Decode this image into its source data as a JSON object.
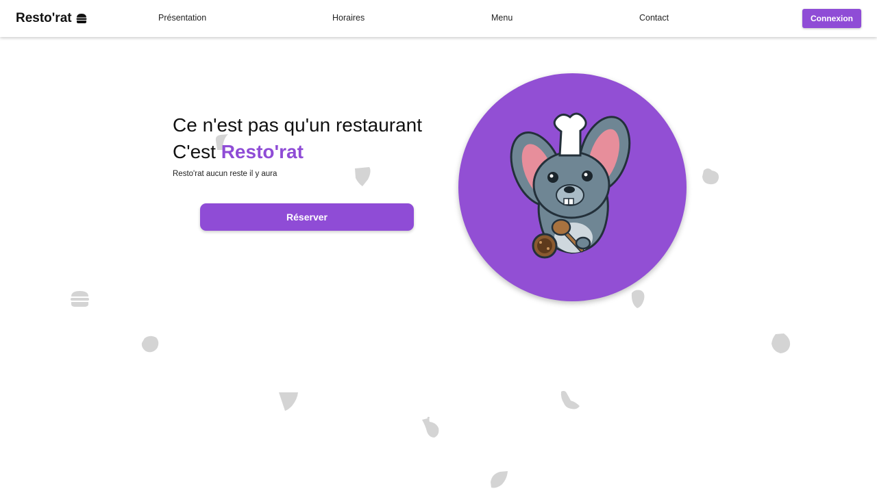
{
  "header": {
    "brand": "Resto'rat",
    "brand_icon": "burger-icon",
    "nav": [
      "Présentation",
      "Horaires",
      "Menu",
      "Contact"
    ],
    "login_label": "Connexion"
  },
  "hero": {
    "headline": "Ce n'est pas qu'un restaurant",
    "brand_prefix": "C'est",
    "brand_accent": "Resto'rat",
    "subtitle": "Resto'rat aucun reste il y aura",
    "cta_label": "Réserver"
  },
  "mascot": {
    "icon": "chef-rat-mascot"
  },
  "colors": {
    "accent": "#8f4cd6",
    "doodle": "#d4d4d4"
  },
  "background_icons": [
    "cheese-icon",
    "apple-icon",
    "burger-icon",
    "steak-icon",
    "egg-icon",
    "cookie-icon",
    "pizza-slice-icon",
    "chicken-leg-icon",
    "fish-icon",
    "herb-leaf-icon"
  ]
}
